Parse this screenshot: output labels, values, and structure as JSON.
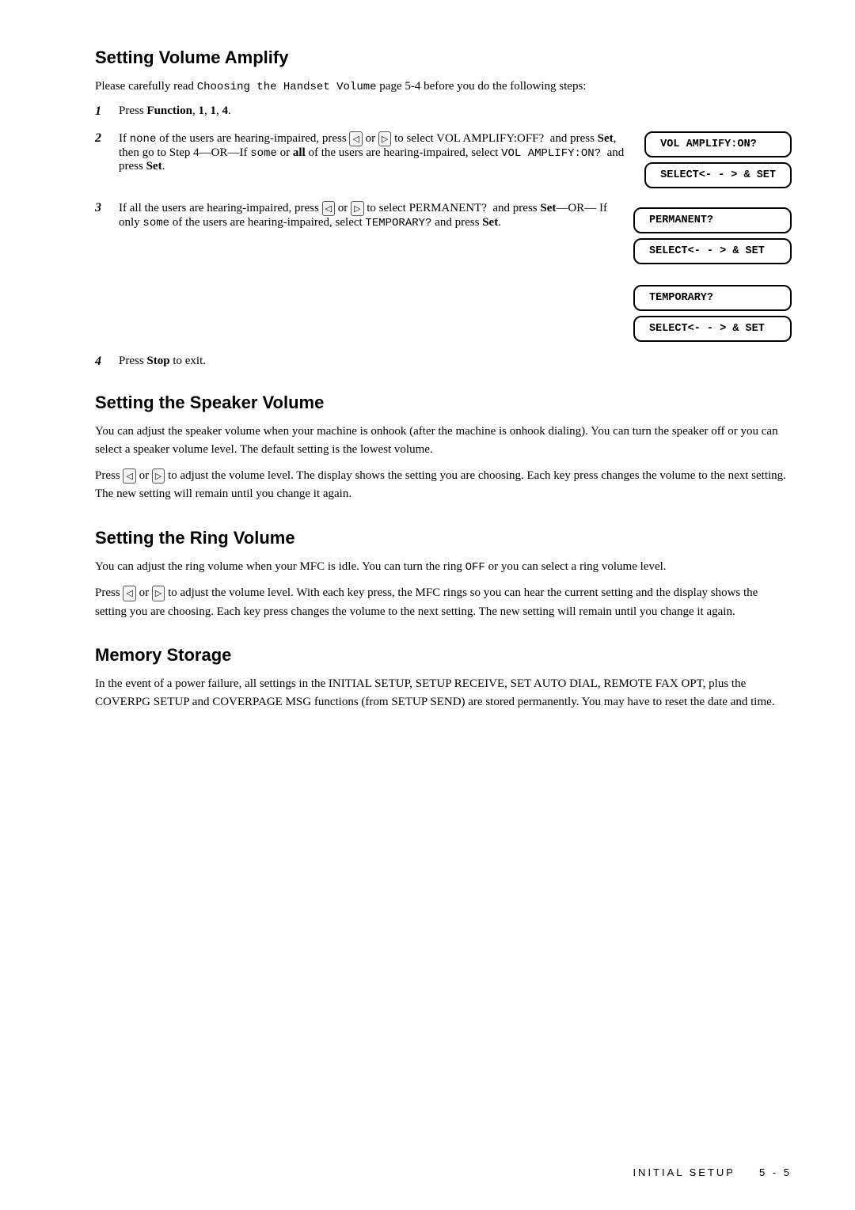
{
  "page": {
    "sections": [
      {
        "id": "setting-volume-amplify",
        "title": "Setting Volume Amplify",
        "intro": "Please carefully read Choosing the Handset Volume page 5-4 before you do the following steps:",
        "intro_mono": "Choosing the Handset Volume",
        "steps": [
          {
            "num": "1",
            "text_parts": [
              {
                "type": "text",
                "content": "Press "
              },
              {
                "type": "bold",
                "content": "Function"
              },
              {
                "type": "text",
                "content": ", "
              },
              {
                "type": "bold",
                "content": "1"
              },
              {
                "type": "text",
                "content": ", "
              },
              {
                "type": "bold",
                "content": "1"
              },
              {
                "type": "text",
                "content": ", "
              },
              {
                "type": "bold",
                "content": "4"
              },
              {
                "type": "text",
                "content": "."
              }
            ]
          },
          {
            "num": "2",
            "has_display": true,
            "display_lines": [
              "VOL AMPLIFY:ON?",
              "SELECT<- - > & SET"
            ],
            "text_before": "If none of the users are hearing-impaired, press ◁ or ▷ to select VOL AMPLIFY:OFF? and press Set, then go to Step 4—OR—If some or all of the users are hearing-impaired, select VOL AMPLIFY:ON? and press Set."
          },
          {
            "num": "3",
            "has_display2": true,
            "display1_lines": [
              "PERMANENT?",
              "SELECT<- - > & SET"
            ],
            "display2_lines": [
              "TEMPORARY?",
              "SELECT<- - > & SET"
            ],
            "text_before": "If all the users are hearing-impaired, press ◁ or ▷ to select PERMANENT? and press Set—OR—If only some of the users are hearing-impaired, select TEMPORARY? and press Set."
          },
          {
            "num": "4",
            "text_parts": [
              {
                "type": "text",
                "content": "Press "
              },
              {
                "type": "bold",
                "content": "Stop"
              },
              {
                "type": "text",
                "content": " to exit."
              }
            ]
          }
        ]
      },
      {
        "id": "setting-speaker-volume",
        "title": "Setting the Speaker Volume",
        "paragraphs": [
          "You can adjust the speaker volume when your machine is onhook (after the machine is onhook dialing). You can turn the speaker off or you can select a speaker volume level. The default setting is the lowest volume.",
          "Press ◁ or ▷ to adjust the volume level. The display shows the setting you are choosing. Each key press changes the volume to the next setting. The new setting will remain until you change it again."
        ]
      },
      {
        "id": "setting-ring-volume",
        "title": "Setting the Ring Volume",
        "paragraphs": [
          "You can adjust the ring volume when your MFC is idle. You can turn the ring OFF or you can select a ring volume level.",
          "Press ◁ or ▷ to adjust the volume level. With each key press, the MFC rings so you can hear the current setting and the display shows the setting you are choosing. Each key press changes the volume to the next setting. The new setting will remain until you change it again."
        ]
      },
      {
        "id": "memory-storage",
        "title": "Memory Storage",
        "paragraphs": [
          "In the event of a power failure, all settings in the INITIAL SETUP, SETUP RECEIVE, SET AUTO DIAL, REMOTE FAX OPT, plus the COVERPG SETUP and COVERPAGE MSG functions (from SETUP SEND) are stored permanently. You may have to reset the date and time."
        ]
      }
    ],
    "footer": {
      "left": "INITIAL SETUP",
      "right": "5 - 5"
    }
  }
}
